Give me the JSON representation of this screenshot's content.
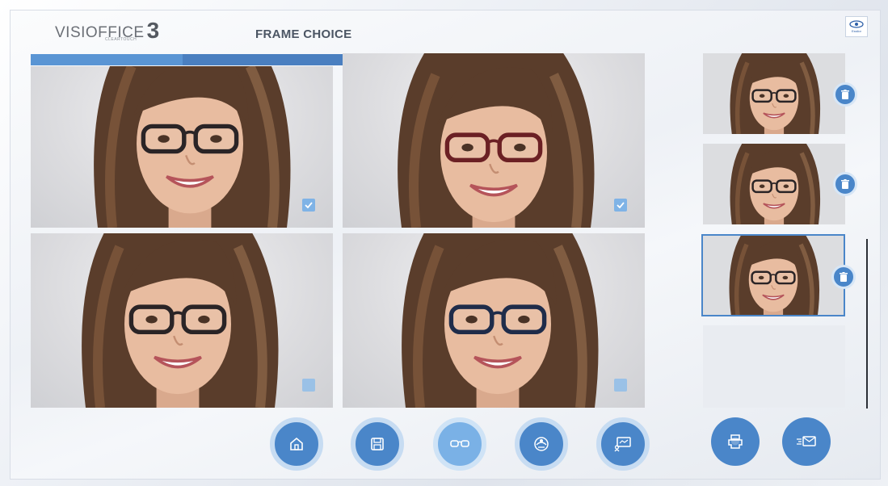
{
  "app": {
    "logo_text": "VISIOFFICE",
    "logo_number": "3",
    "logo_subtext": "CLEARTOUCH",
    "screen_title": "FRAME CHOICE",
    "brand_badge_text": "Essilor"
  },
  "progress": {
    "value_fraction": 0.46
  },
  "main_photos": [
    {
      "name": "photo-frame-1",
      "frame_color": "#2a2426",
      "checked": true
    },
    {
      "name": "photo-frame-2",
      "frame_color": "#6b2024",
      "checked": true
    },
    {
      "name": "photo-frame-3",
      "frame_color": "#2a2426",
      "checked": false
    },
    {
      "name": "photo-frame-4",
      "frame_color": "#1f2c4a",
      "checked": false
    }
  ],
  "thumbnails": [
    {
      "name": "thumbnail-1",
      "selected": false
    },
    {
      "name": "thumbnail-2",
      "selected": false
    },
    {
      "name": "thumbnail-3",
      "selected": true
    }
  ],
  "nav_buttons": [
    {
      "name": "home-button",
      "icon": "home-icon",
      "active": false
    },
    {
      "name": "save-button",
      "icon": "save-icon",
      "active": false
    },
    {
      "name": "frame-choice-button",
      "icon": "glasses-icon",
      "active": true
    },
    {
      "name": "lens-demo-button",
      "icon": "lens-icon",
      "active": false
    },
    {
      "name": "presentation-button",
      "icon": "presentation-icon",
      "active": false
    }
  ],
  "action_buttons": [
    {
      "name": "print-button",
      "icon": "print-icon"
    },
    {
      "name": "send-email-button",
      "icon": "email-icon"
    }
  ],
  "colors": {
    "accent": "#4a86c9",
    "accent_light": "#7ab1e6",
    "progress_track": "#4a7fc0",
    "progress_fill": "#5a95d4"
  }
}
